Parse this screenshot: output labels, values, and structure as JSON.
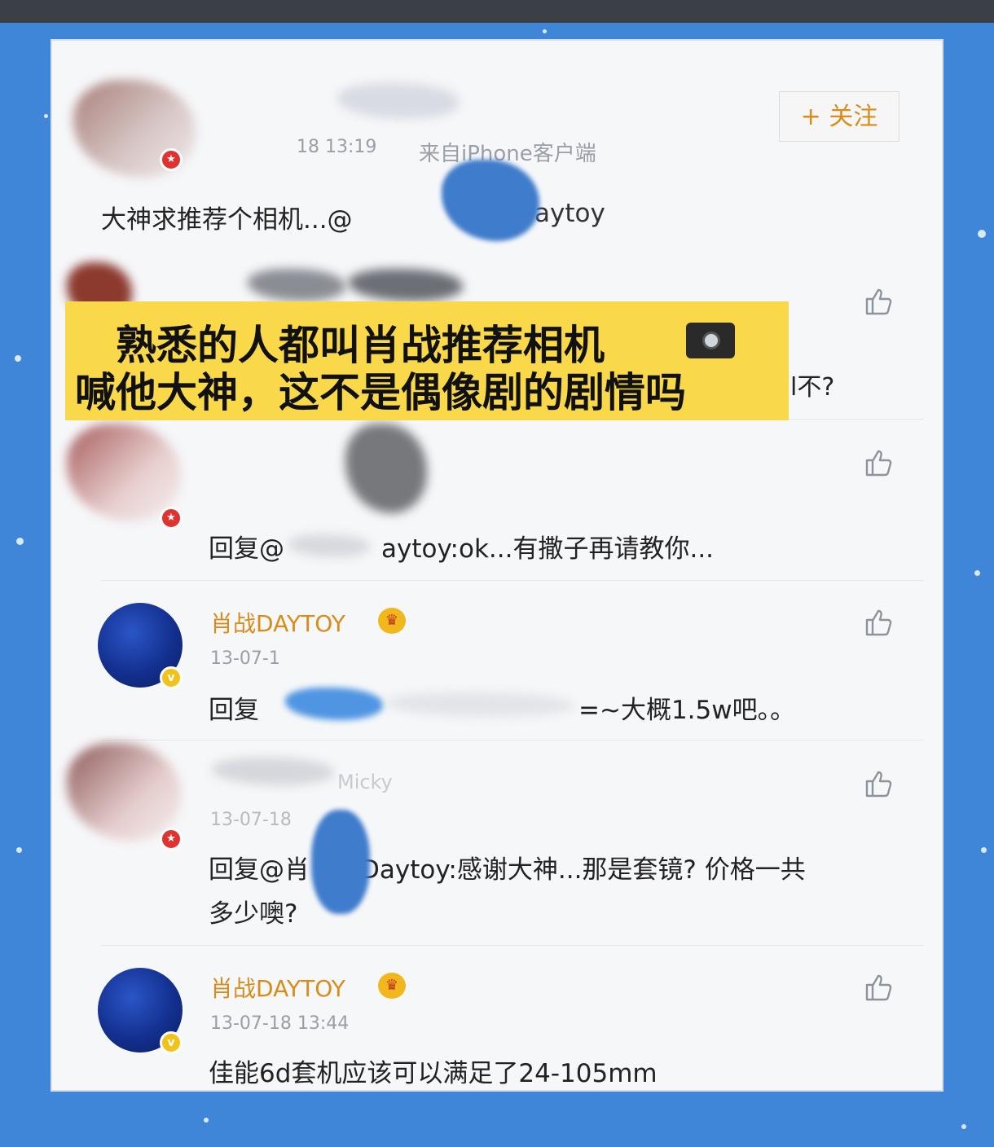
{
  "follow_button": "+ 关注",
  "comment1": {
    "time": "18 13:19",
    "source": "来自iPhone客户端",
    "text": "大神求推荐个相机...@",
    "mention_tail": "aytoy"
  },
  "overlay": {
    "line1": "熟悉的人都叫肖战推荐相机",
    "line2": "喊他大神，这不是偶像剧的剧情吗",
    "camera_icon": "camera-icon"
  },
  "comment2": {
    "partial_text": "l不?"
  },
  "comment3": {
    "reply_prefix": "回复@",
    "text": "aytoy:ok...有撒子再请教你..."
  },
  "comment4": {
    "name": "肖战DAYTOY",
    "time": "13-07-1",
    "reply_prefix": "回复",
    "text": "=~大概1.5w吧。。"
  },
  "comment5": {
    "name_partial": "Micky",
    "time": "13-07-18",
    "reply_prefix": "回复@肖",
    "text": "Daytoy:感谢大神...那是套镜? 价格一共",
    "text_line2": "多少噢?"
  },
  "comment6": {
    "name": "肖战DAYTOY",
    "time": "13-07-18 13:44",
    "text": "佳能6d套机应该可以满足了24-105mm"
  },
  "colors": {
    "background": "#3f86d8",
    "username": "#d98c1a",
    "overlay": "#f9d94a"
  }
}
